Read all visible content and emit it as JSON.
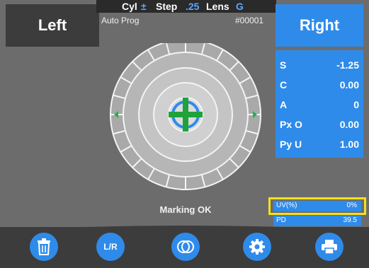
{
  "header": {
    "cyl_label": "Cyl",
    "cyl_value": "±",
    "step_label": "Step",
    "step_value": ".25",
    "lens_label": "Lens",
    "lens_value": "G",
    "auto_prog": "Auto Prog",
    "measurement_no": "#00001"
  },
  "side_buttons": {
    "left": "Left",
    "right": "Right"
  },
  "readings": [
    {
      "label": "S",
      "value": "-1.25"
    },
    {
      "label": "C",
      "value": "0.00"
    },
    {
      "label": "A",
      "value": "0"
    },
    {
      "label": "Px O",
      "value": "0.00"
    },
    {
      "label": "Py U",
      "value": "1.00"
    }
  ],
  "status": {
    "marking": "Marking OK"
  },
  "uv": {
    "label": "UV(%)",
    "value": "0%"
  },
  "pd": {
    "label": "PD",
    "value": "39.5"
  },
  "toolbar": {
    "icons": [
      "trash-icon",
      "lr-icon",
      "lens-icon",
      "gear-icon",
      "printer-icon"
    ],
    "lr_label": "L/R"
  },
  "colors": {
    "accent": "#2f8bea",
    "highlight": "#f2e21a",
    "crosshair": "#1fa23a",
    "background": "#6c6c6c"
  }
}
